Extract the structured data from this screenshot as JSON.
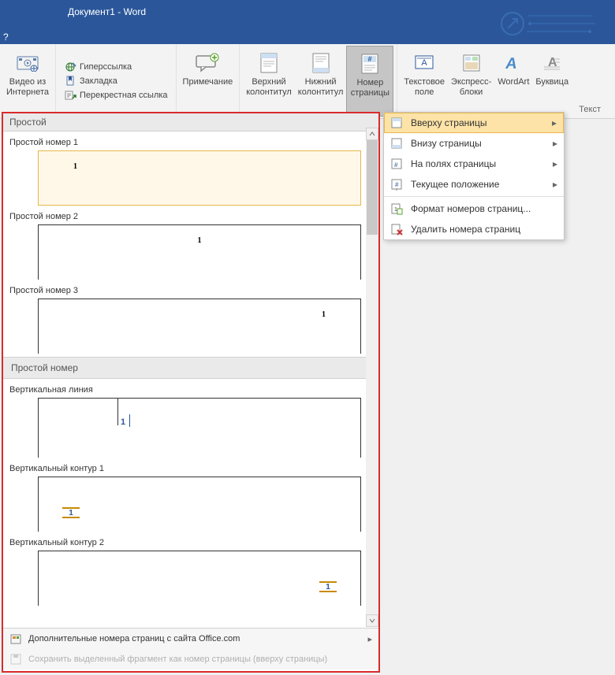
{
  "title": "Документ1 - Word",
  "help": "?",
  "ribbon": {
    "video": {
      "label": "Видео из\nИнтернета"
    },
    "links": {
      "hyperlink": "Гиперссылка",
      "bookmark": "Закладка",
      "crossref": "Перекрестная ссылка"
    },
    "comment": {
      "label": "Примечание"
    },
    "header": {
      "label": "Верхний\nколонтитул"
    },
    "footer": {
      "label": "Нижний\nколонтитул"
    },
    "pagenum": {
      "label": "Номер\nстраницы"
    },
    "textbox": {
      "label": "Текстовое\nполе"
    },
    "quickparts": {
      "label": "Экспресс-\nблоки"
    },
    "wordart": {
      "label": "WordArt"
    },
    "dropcap": {
      "label": "Буквица"
    },
    "text_group": "Текст"
  },
  "menu": {
    "top": "Вверху страницы",
    "bottom": "Внизу страницы",
    "margins": "На полях страницы",
    "current": "Текущее положение",
    "format": "Формат номеров страниц...",
    "remove": "Удалить номера страниц"
  },
  "gallery": {
    "section1": "Простой",
    "items1": [
      {
        "title": "Простой номер 1"
      },
      {
        "title": "Простой номер 2"
      },
      {
        "title": "Простой номер 3"
      }
    ],
    "section2": "Простой номер",
    "items2": [
      {
        "title": "Вертикальная линия"
      },
      {
        "title": "Вертикальный контур 1"
      },
      {
        "title": "Вертикальный контур 2"
      }
    ],
    "num": "1",
    "footer_more": "Дополнительные номера страниц с сайта Office.com",
    "footer_save": "Сохранить выделенный фрагмент как номер страницы (вверху страницы)"
  }
}
